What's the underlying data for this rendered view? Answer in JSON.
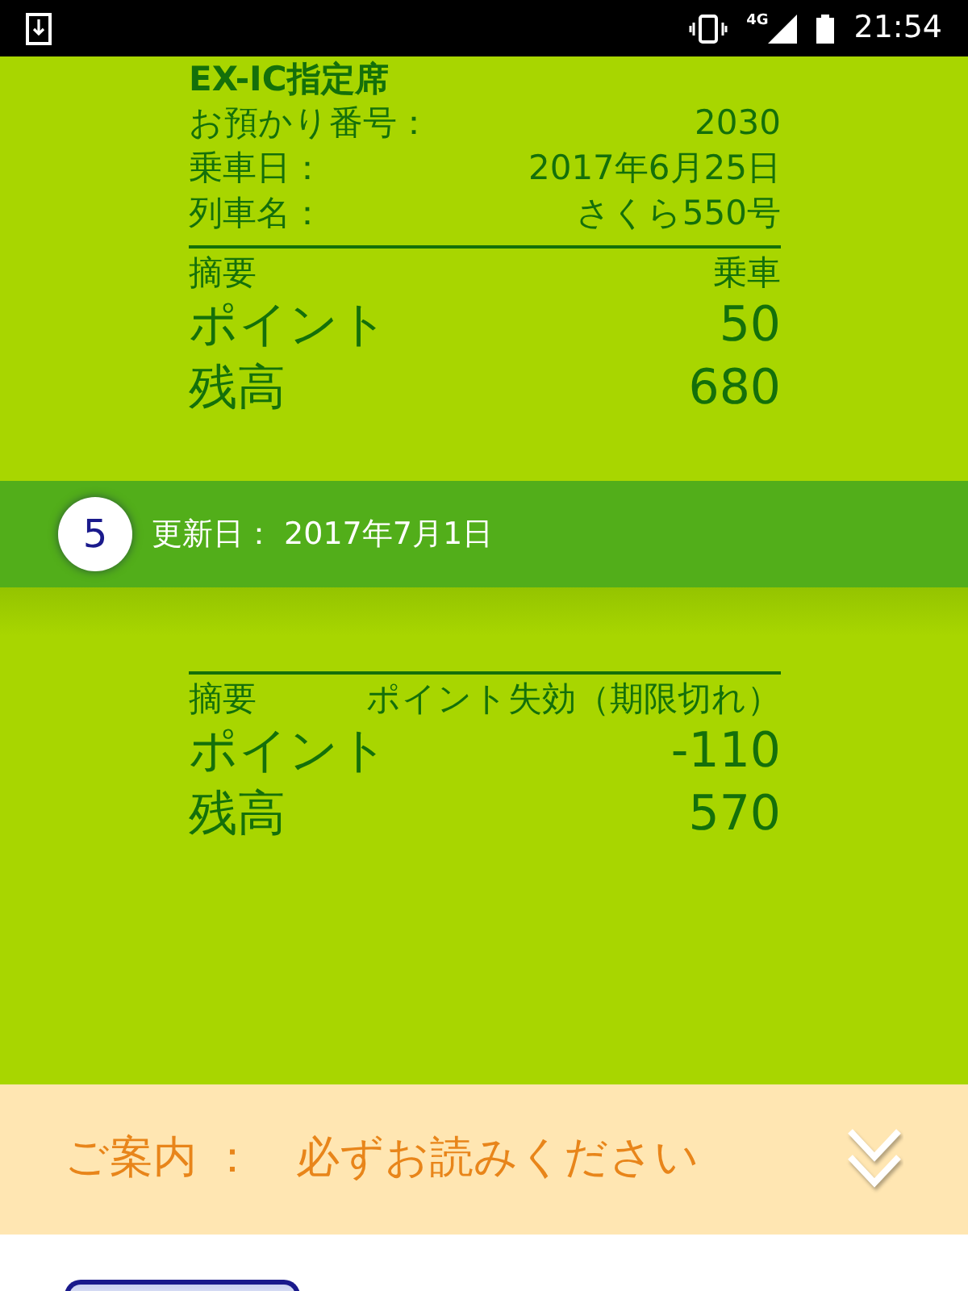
{
  "status_bar": {
    "time": "21:54",
    "network": "4G"
  },
  "previous_entry": {
    "title": "EX-IC指定席",
    "details": [
      {
        "label": "お預かり番号：",
        "value": "2030"
      },
      {
        "label": "乗車日：",
        "value": "2017年6月25日"
      },
      {
        "label": "列車名：",
        "value": "さくら550号"
      }
    ],
    "summary": {
      "label": "摘要",
      "value": "乗車"
    },
    "totals": [
      {
        "label": "ポイント",
        "value": "50"
      },
      {
        "label": "残高",
        "value": "680"
      }
    ]
  },
  "entry": {
    "number": "5",
    "updated": "更新日： 2017年7月1日",
    "summary": {
      "label": "摘要",
      "value": "ポイント失効（期限切れ）"
    },
    "totals": [
      {
        "label": "ポイント",
        "value": "-110"
      },
      {
        "label": "残高",
        "value": "570"
      }
    ]
  },
  "notice": {
    "label": "ご案内 ：",
    "text": "必ずお読みください",
    "expanded": false
  }
}
